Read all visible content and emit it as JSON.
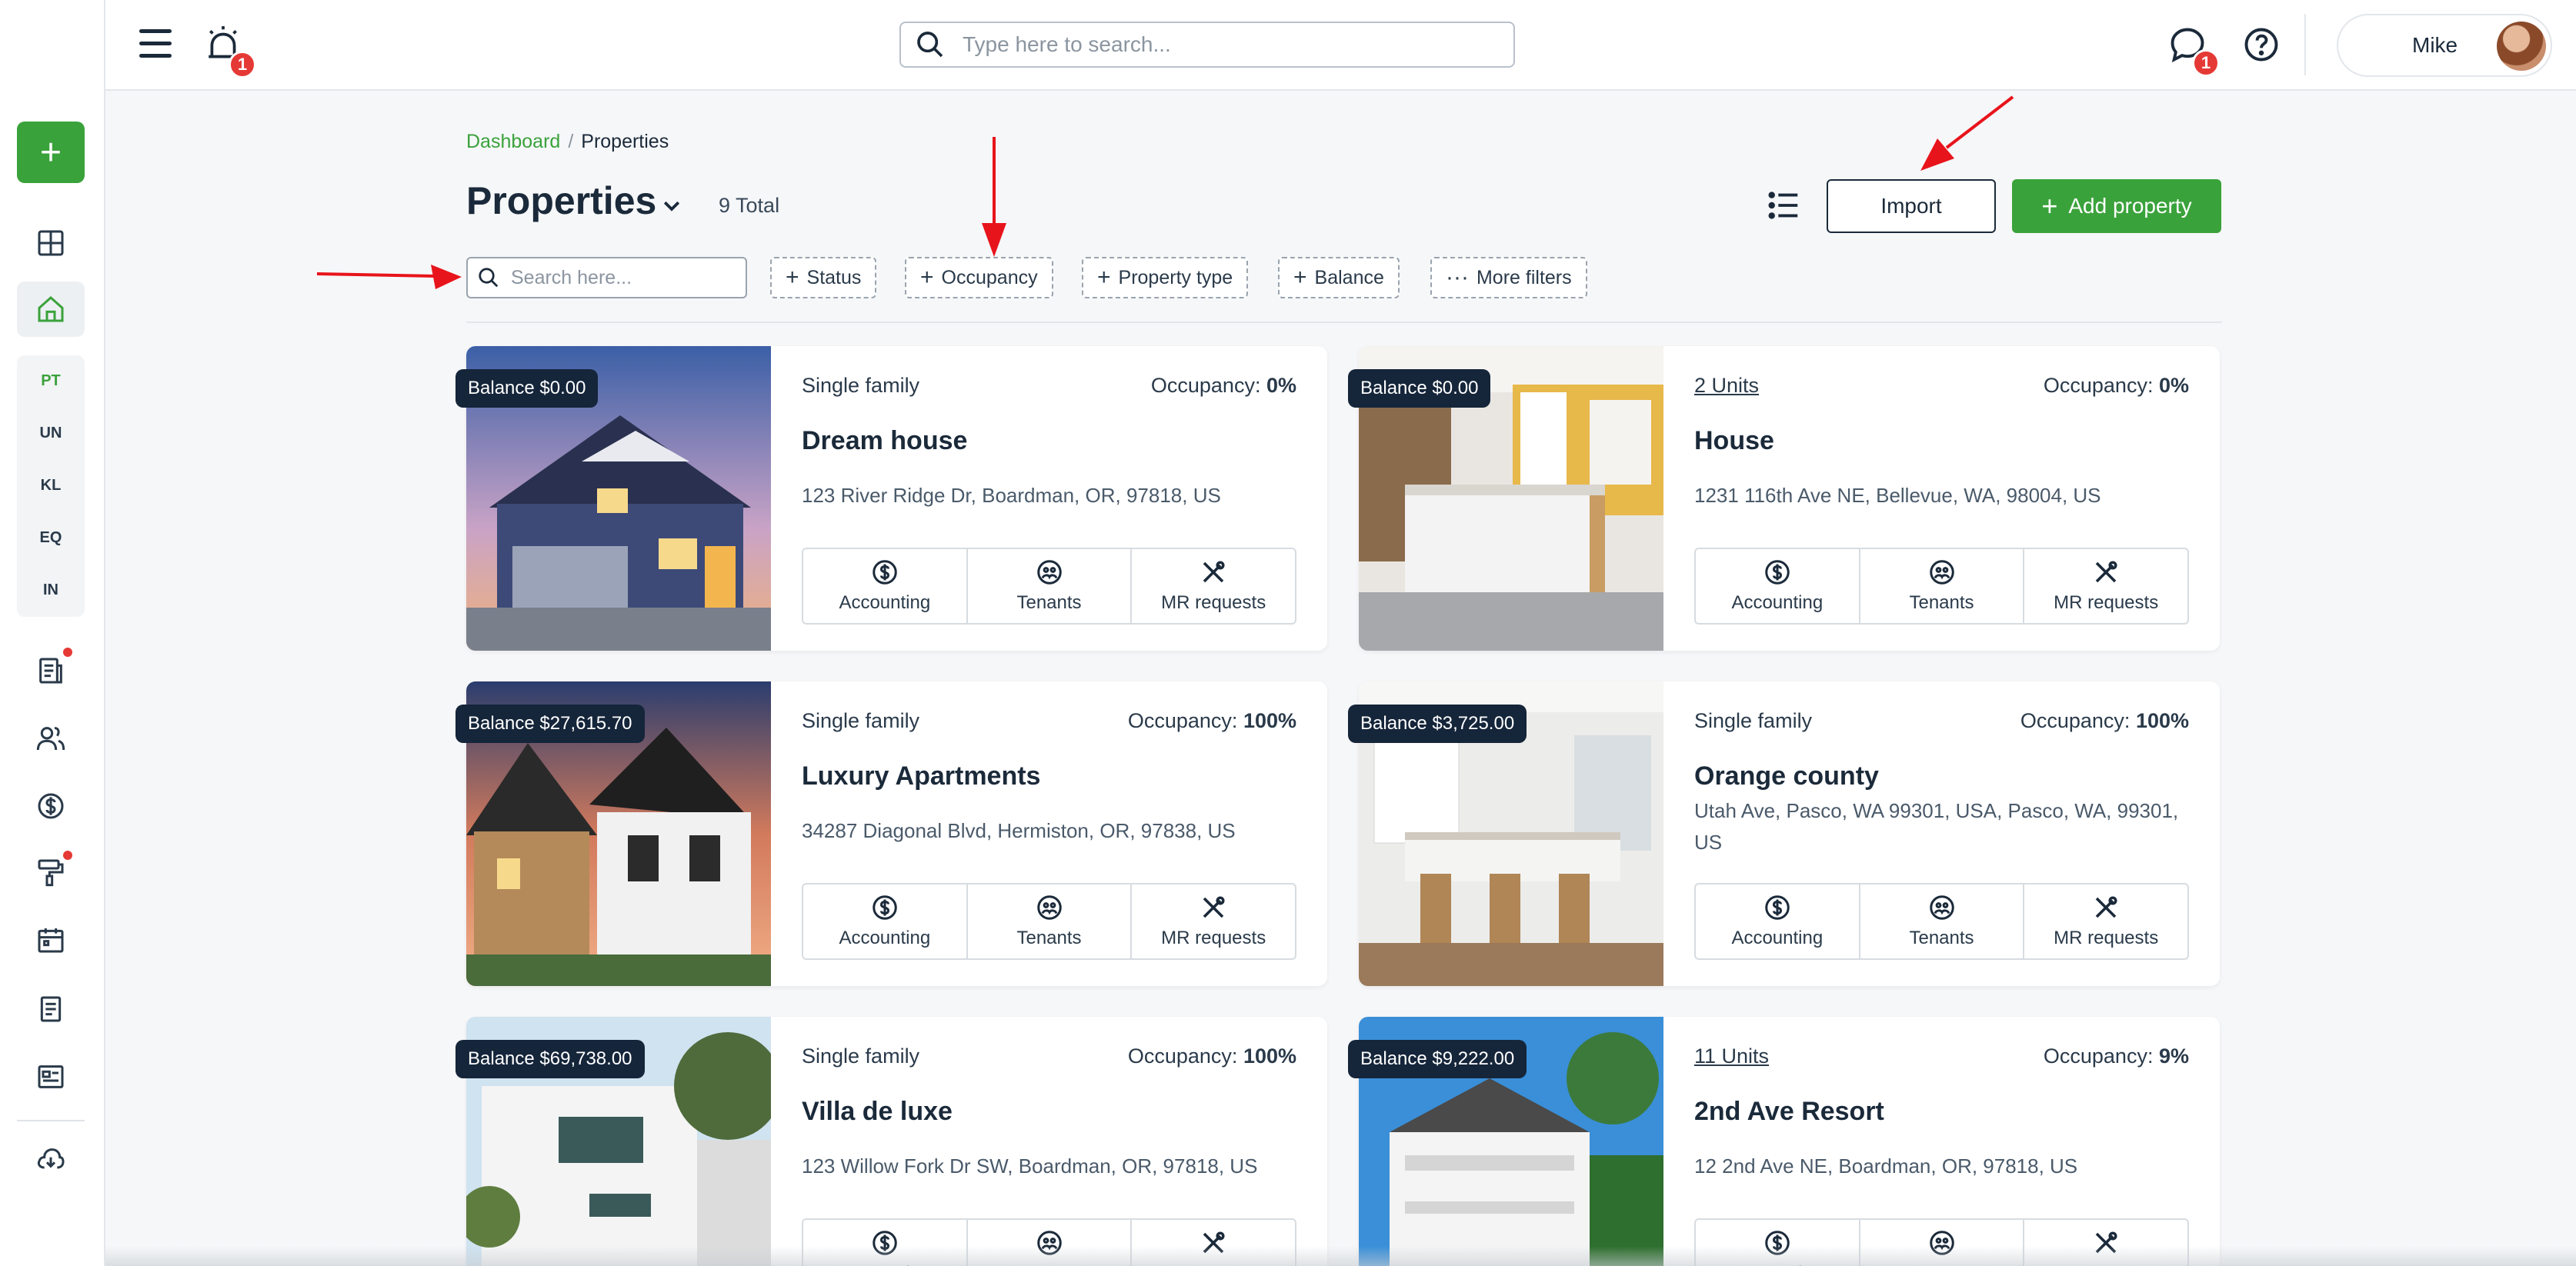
{
  "header": {
    "notification_count": "1",
    "search_placeholder": "Type here to search...",
    "chat_count": "1",
    "user_name": "Mike"
  },
  "sidebar": {
    "add_label": "+",
    "abbreviations": [
      "PT",
      "UN",
      "KL",
      "EQ",
      "IN"
    ]
  },
  "breadcrumb": {
    "dashboard": "Dashboard",
    "separator": "/",
    "current": "Properties"
  },
  "page": {
    "title": "Properties",
    "total": "9 Total",
    "import_label": "Import",
    "add_label": "Add property",
    "add_icon": "+"
  },
  "filters": {
    "search_placeholder": "Search here...",
    "chips": [
      {
        "icon": "+",
        "label": "Status"
      },
      {
        "icon": "+",
        "label": "Occupancy"
      },
      {
        "icon": "+",
        "label": "Property type"
      },
      {
        "icon": "+",
        "label": "Balance"
      },
      {
        "icon": "···",
        "label": "More filters"
      }
    ]
  },
  "cards": [
    {
      "balance": "Balance $0.00",
      "type": "Single family",
      "occ_label": "Occupancy:",
      "occ_value": "0%",
      "name": "Dream house",
      "address": "123 River Ridge Dr, Boardman, OR, 97818, US"
    },
    {
      "balance": "Balance $0.00",
      "type": "2 Units",
      "occ_label": "Occupancy:",
      "occ_value": "0%",
      "name": "House",
      "address": "1231 116th Ave NE, Bellevue, WA, 98004, US"
    },
    {
      "balance": "Balance $27,615.70",
      "type": "Single family",
      "occ_label": "Occupancy:",
      "occ_value": "100%",
      "name": "Luxury Apartments",
      "address": "34287 Diagonal Blvd, Hermiston, OR, 97838, US"
    },
    {
      "balance": "Balance $3,725.00",
      "type": "Single family",
      "occ_label": "Occupancy:",
      "occ_value": "100%",
      "name": "Orange county",
      "address": "Utah Ave, Pasco, WA 99301, USA, Pasco, WA, 99301, US"
    },
    {
      "balance": "Balance $69,738.00",
      "type": "Single family",
      "occ_label": "Occupancy:",
      "occ_value": "100%",
      "name": "Villa de luxe",
      "address": "123 Willow Fork Dr SW, Boardman, OR, 97818, US"
    },
    {
      "balance": "Balance $9,222.00",
      "type": "11 Units",
      "occ_label": "Occupancy:",
      "occ_value": "9%",
      "name": "2nd Ave Resort",
      "address": "12 2nd Ave NE, Boardman, OR, 97818, US"
    }
  ],
  "actions": {
    "accounting": "Accounting",
    "tenants": "Tenants",
    "mr_requests": "MR requests"
  },
  "colors": {
    "accent": "#3aa23b",
    "navy": "#15253a",
    "badge": "#e53935",
    "annotation": "#e8141b"
  }
}
